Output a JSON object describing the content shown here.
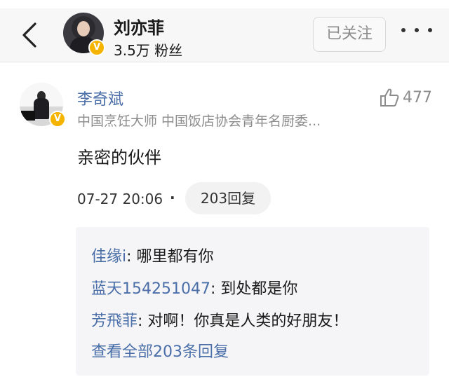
{
  "header": {
    "user_name": "刘亦菲",
    "fans": "3.5万 粉丝",
    "follow_label": "已关注",
    "verified_badge": "V"
  },
  "comment": {
    "author": "李奇斌",
    "author_title": "中国烹饪大师 中国饭店协会青年名厨委...",
    "likes": "477",
    "text": "亲密的伙伴",
    "time": "07-27 20:06",
    "separator": "·",
    "reply_count_label": "203回复",
    "verified_badge": "V"
  },
  "replies": {
    "items": [
      {
        "user": "佳缘i",
        "sep": ": ",
        "text": "哪里都有你"
      },
      {
        "user": "蓝天154251047",
        "sep": ": ",
        "text": "到处都是你"
      },
      {
        "user": "芳飛菲",
        "sep": ": ",
        "text": "对啊！你真是人类的好朋友！"
      }
    ],
    "view_all": "查看全部203条回复"
  },
  "colors": {
    "link_blue": "#4a6ea8",
    "verified_gold": "#f5b400",
    "muted_gray": "#8c8c8c"
  },
  "icons": [
    "back-arrow-icon",
    "more-dots-icon",
    "thumbs-up-icon",
    "verified-v-icon"
  ]
}
